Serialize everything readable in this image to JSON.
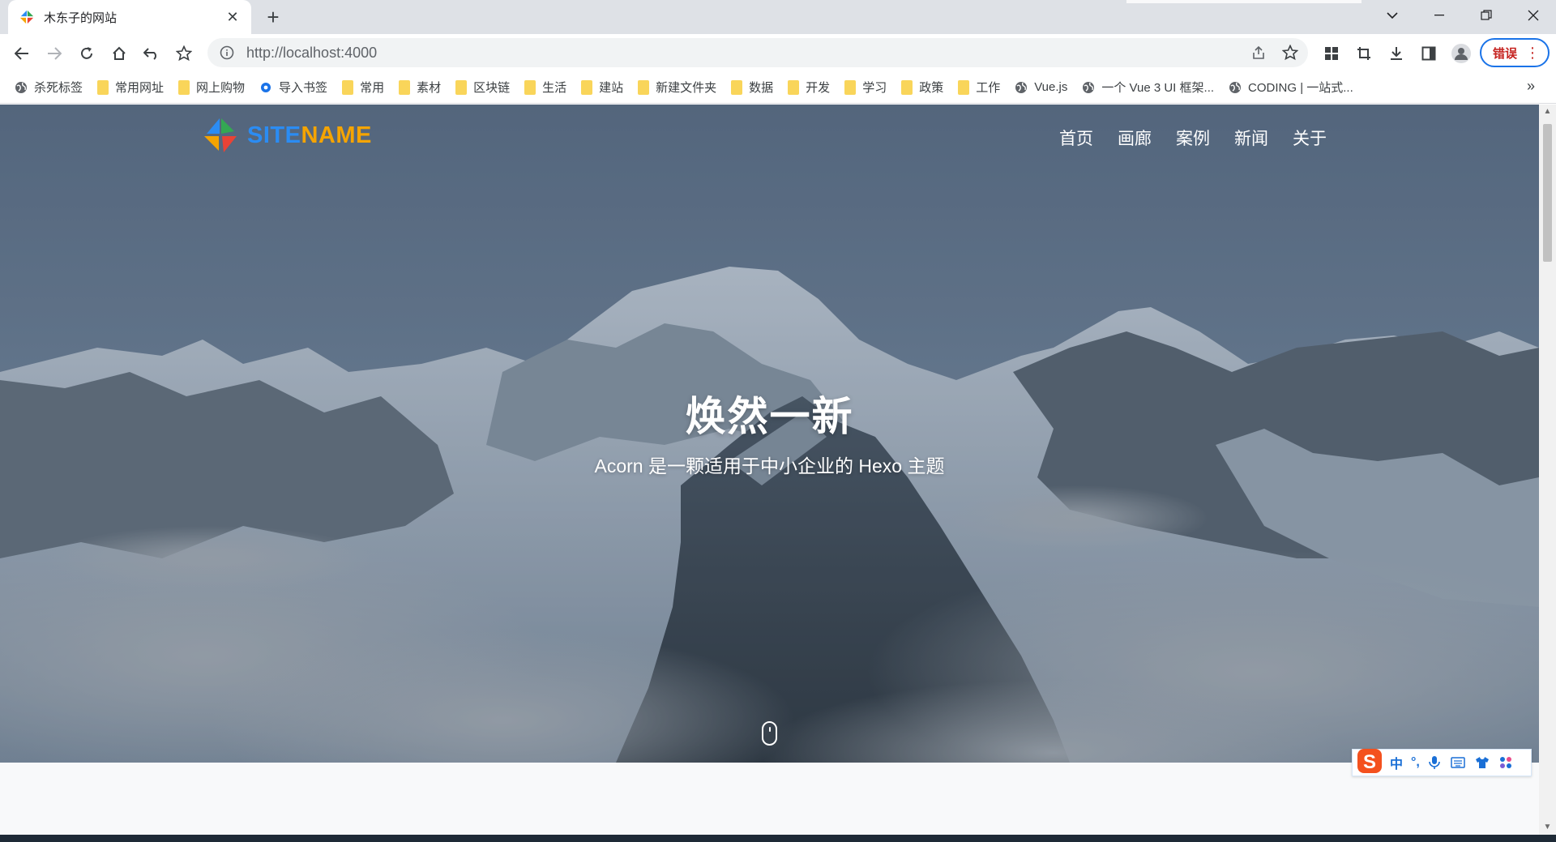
{
  "browser": {
    "tab_title": "木东子的网站",
    "url": "http://localhost:4000",
    "error_button_label": "错误"
  },
  "bookmarks": [
    {
      "label": "杀死标签",
      "icon": "globe-icon"
    },
    {
      "label": "常用网址",
      "icon": "folder-icon"
    },
    {
      "label": "网上购物",
      "icon": "folder-icon"
    },
    {
      "label": "导入书签",
      "icon": "gear-icon"
    },
    {
      "label": "常用",
      "icon": "folder-icon"
    },
    {
      "label": "素材",
      "icon": "folder-icon"
    },
    {
      "label": "区块链",
      "icon": "folder-icon"
    },
    {
      "label": "生活",
      "icon": "folder-icon"
    },
    {
      "label": "建站",
      "icon": "folder-icon"
    },
    {
      "label": "新建文件夹",
      "icon": "folder-icon"
    },
    {
      "label": "数据",
      "icon": "folder-icon"
    },
    {
      "label": "开发",
      "icon": "folder-icon"
    },
    {
      "label": "学习",
      "icon": "folder-icon"
    },
    {
      "label": "政策",
      "icon": "folder-icon"
    },
    {
      "label": "工作",
      "icon": "folder-icon"
    },
    {
      "label": "Vue.js",
      "icon": "globe-icon"
    },
    {
      "label": "一个 Vue 3 UI 框架...",
      "icon": "globe-icon"
    },
    {
      "label": "CODING | 一站式...",
      "icon": "globe-icon"
    }
  ],
  "site": {
    "logo_text_part1": "SITE",
    "logo_text_part2": "NAME",
    "nav": [
      "首页",
      "画廊",
      "案例",
      "新闻",
      "关于"
    ],
    "hero_title": "焕然一新",
    "hero_subtitle": "Acorn 是一颗适用于中小企业的 Hexo 主题"
  },
  "ime": {
    "items": [
      "中",
      "°,",
      "mic-icon",
      "keyboard-icon",
      "shirt-icon",
      "apps-icon"
    ],
    "lang": "中",
    "punct": "°,"
  },
  "colors": {
    "logo_blue": "#2b8cf3",
    "logo_orange": "#f5a400",
    "accent": "#1a73e8"
  }
}
